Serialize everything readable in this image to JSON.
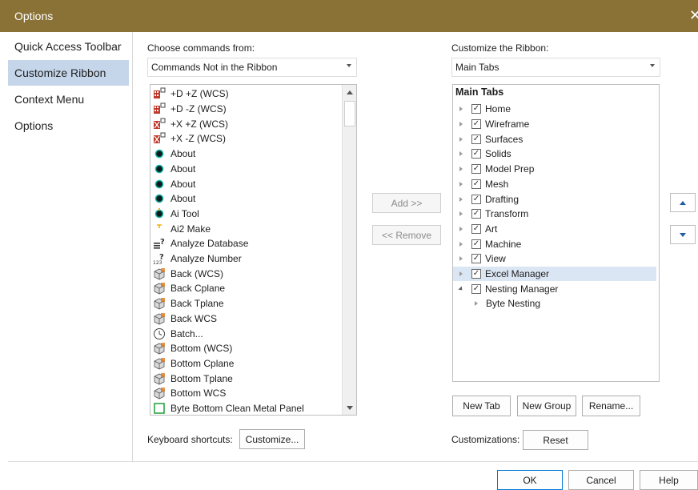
{
  "window": {
    "title": "Options"
  },
  "nav": {
    "items": [
      {
        "label": "Quick Access Toolbar",
        "selected": false
      },
      {
        "label": "Customize Ribbon",
        "selected": true
      },
      {
        "label": "Context Menu",
        "selected": false
      },
      {
        "label": "Options",
        "selected": false
      }
    ]
  },
  "left_panel": {
    "choose_label": "Choose commands from:",
    "choose_value": "Commands Not in the Ribbon",
    "commands": [
      {
        "label": "+D +Z (WCS)",
        "icon": "plane-d-icon"
      },
      {
        "label": "+D -Z (WCS)",
        "icon": "plane-d-icon"
      },
      {
        "label": "+X +Z (WCS)",
        "icon": "plane-x-icon"
      },
      {
        "label": "+X -Z (WCS)",
        "icon": "plane-x-icon"
      },
      {
        "label": "About",
        "icon": "about-dot-icon"
      },
      {
        "label": "About",
        "icon": "about-dot-icon"
      },
      {
        "label": "About",
        "icon": "about-dot-icon"
      },
      {
        "label": "About",
        "icon": "about-dot-icon"
      },
      {
        "label": "Ai Tool",
        "icon": "ai-tool-icon"
      },
      {
        "label": "Ai2 Make",
        "icon": "ai-make-icon"
      },
      {
        "label": "Analyze Database",
        "icon": "analyze-database-icon"
      },
      {
        "label": "Analyze Number",
        "icon": "analyze-number-icon"
      },
      {
        "label": "Back (WCS)",
        "icon": "view-cube-icon"
      },
      {
        "label": "Back Cplane",
        "icon": "view-cube-icon"
      },
      {
        "label": "Back Tplane",
        "icon": "view-cube-icon"
      },
      {
        "label": "Back WCS",
        "icon": "view-cube-icon"
      },
      {
        "label": "Batch...",
        "icon": "clock-icon"
      },
      {
        "label": "Bottom (WCS)",
        "icon": "view-cube-icon"
      },
      {
        "label": "Bottom Cplane",
        "icon": "view-cube-icon"
      },
      {
        "label": "Bottom Tplane",
        "icon": "view-cube-icon"
      },
      {
        "label": "Bottom WCS",
        "icon": "view-cube-icon"
      },
      {
        "label": "Byte Bottom Clean Metal Panel",
        "icon": "green-square-icon"
      }
    ],
    "keyboard_label": "Keyboard shortcuts:",
    "customize_button": "Customize..."
  },
  "middle": {
    "add_button": "Add >>",
    "remove_button": "<< Remove"
  },
  "right_panel": {
    "customize_label": "Customize the Ribbon:",
    "customize_value": "Main Tabs",
    "tree_header": "Main Tabs",
    "tabs": [
      {
        "label": "Home",
        "checked": true,
        "expanded": false,
        "selected": false
      },
      {
        "label": "Wireframe",
        "checked": true,
        "expanded": false,
        "selected": false
      },
      {
        "label": "Surfaces",
        "checked": true,
        "expanded": false,
        "selected": false
      },
      {
        "label": "Solids",
        "checked": true,
        "expanded": false,
        "selected": false
      },
      {
        "label": "Model Prep",
        "checked": true,
        "expanded": false,
        "selected": false
      },
      {
        "label": "Mesh",
        "checked": true,
        "expanded": false,
        "selected": false
      },
      {
        "label": "Drafting",
        "checked": true,
        "expanded": false,
        "selected": false
      },
      {
        "label": "Transform",
        "checked": true,
        "expanded": false,
        "selected": false
      },
      {
        "label": "Art",
        "checked": true,
        "expanded": false,
        "selected": false
      },
      {
        "label": "Machine",
        "checked": true,
        "expanded": false,
        "selected": false
      },
      {
        "label": "View",
        "checked": true,
        "expanded": false,
        "selected": false
      },
      {
        "label": "Excel Manager",
        "checked": true,
        "expanded": false,
        "selected": true
      },
      {
        "label": "Nesting Manager",
        "checked": true,
        "expanded": true,
        "selected": false
      }
    ],
    "subgroup": {
      "label": "Byte Nesting"
    },
    "new_tab_button": "New Tab",
    "new_group_button": "New Group",
    "rename_button": "Rename...",
    "customizations_label": "Customizations:",
    "reset_button": "Reset"
  },
  "footer": {
    "ok_button": "OK",
    "cancel_button": "Cancel",
    "help_button": "Help"
  },
  "colors": {
    "titlebar": "#8a7236",
    "nav_selected": "#c5d5ea",
    "tree_selected": "#dbe6f4"
  }
}
